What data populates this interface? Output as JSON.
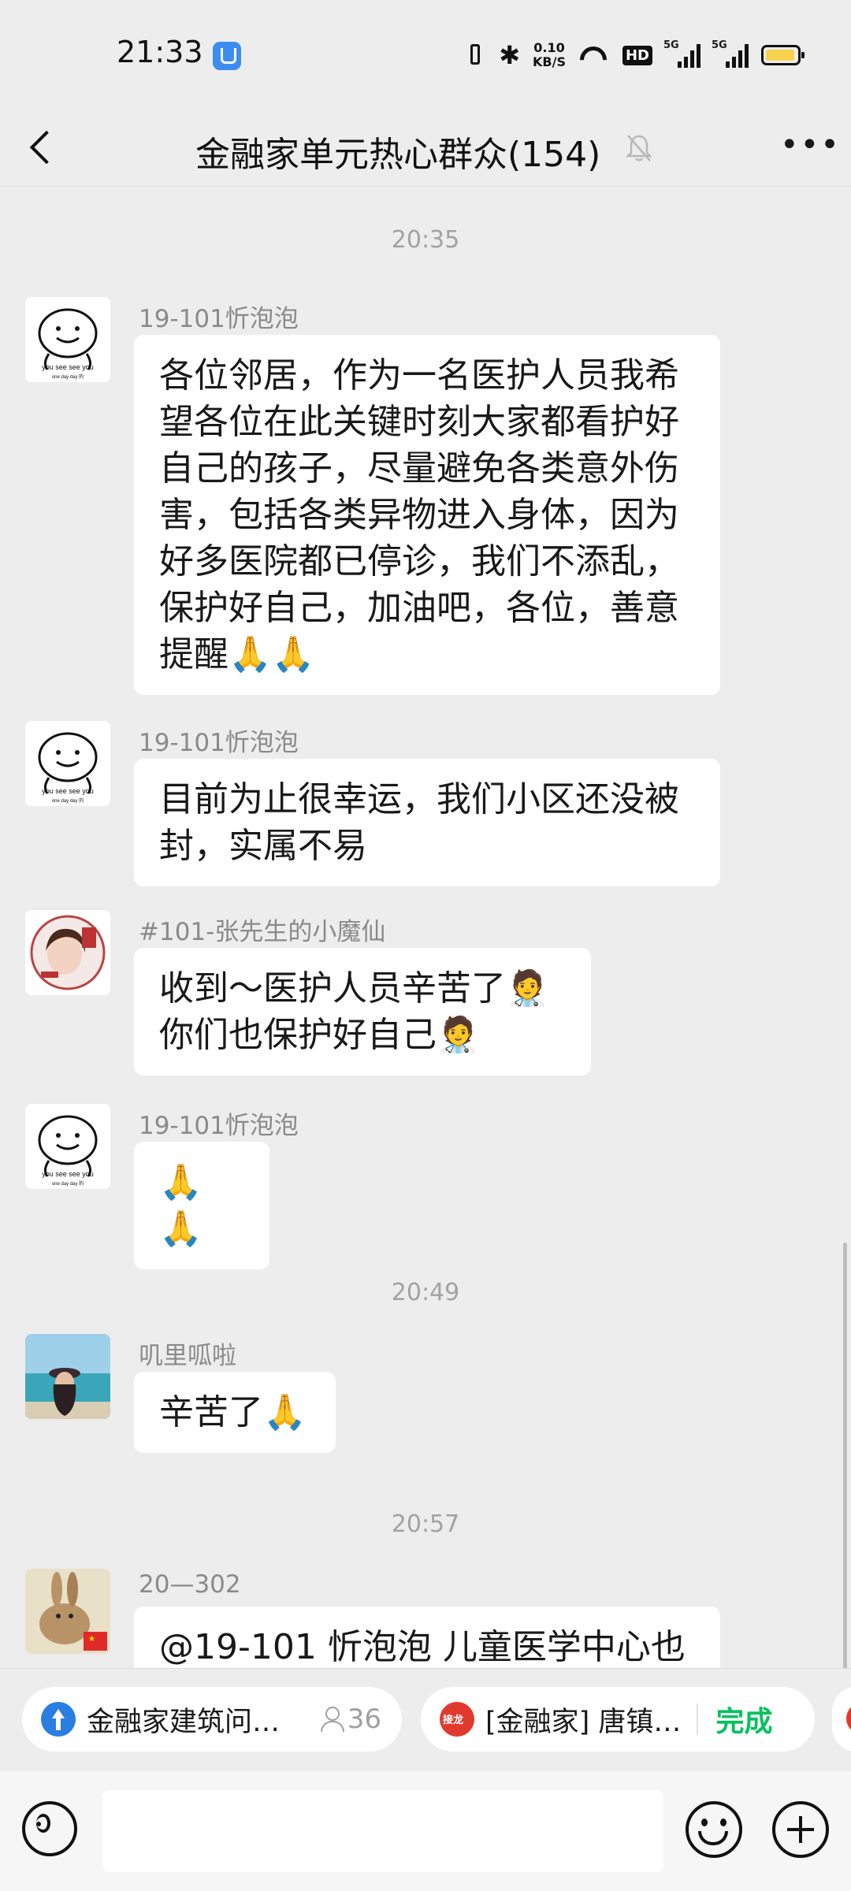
{
  "status_bar": {
    "time": "21:33",
    "net_speed_value": "0.10",
    "net_speed_unit": "KB/S",
    "hd_badge": "HD",
    "signal1_label": "5G",
    "signal2_label": "5G",
    "battery_color": "#f7d24c"
  },
  "header": {
    "title": "金融家单元热心群众(154)"
  },
  "messages": [
    {
      "timestamp": "20:35"
    },
    {
      "sender": "19-101忻泡泡",
      "text": "各位邻居，作为一名医护人员我希望各位在此关键时刻大家都看护好自己的孩子，尽量避免各类意外伤害，包括各类异物进入身体，因为好多医院都已停诊，我们不添乱，保护好自己，加油吧，各位，善意提醒🙏🙏"
    },
    {
      "sender": "19-101忻泡泡",
      "text": "目前为止很幸运，我们小区还没被封，实属不易"
    },
    {
      "sender": "#101-张先生的小魔仙",
      "text": "收到～医护人员辛苦了🧑‍⚕️\n你们也保护好自己🧑‍⚕️"
    },
    {
      "sender": "19-101忻泡泡",
      "text": "🙏🙏"
    },
    {
      "timestamp": "20:49"
    },
    {
      "sender": "叽里呱啦",
      "text": "辛苦了🙏"
    },
    {
      "timestamp": "20:57"
    },
    {
      "sender": "20—302",
      "text": "@19-101 忻泡泡  儿童医学中心也"
    }
  ],
  "avatar_caption": {
    "line1": "you see see you",
    "line2": "one day day 的"
  },
  "quick_cards": [
    {
      "label": "金融家建筑问…",
      "count": "36",
      "icon": "arrow-up-icon"
    },
    {
      "label": "[金融家] 唐镇…",
      "icon_text": "接龙",
      "action": "完成",
      "action_color": "#07c160"
    }
  ],
  "input": {
    "placeholder": ""
  }
}
